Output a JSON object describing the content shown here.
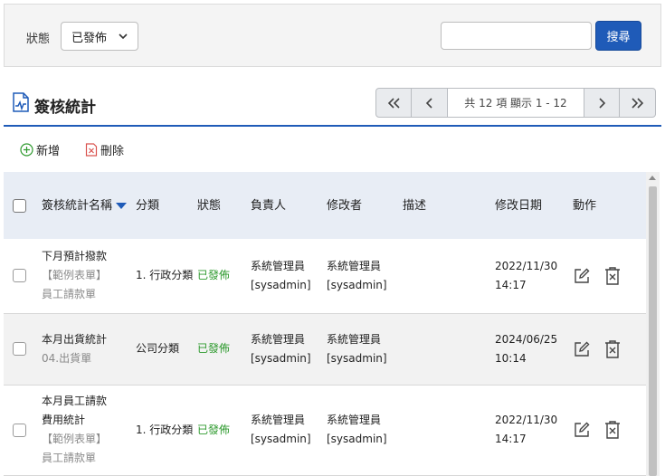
{
  "filter": {
    "status_label": "狀態",
    "status_value": "已發佈",
    "search_placeholder": "",
    "search_button": "搜尋"
  },
  "header": {
    "title": "簽核統計",
    "pager_info": "共 12 項 顯示 1 - 12"
  },
  "toolbar": {
    "add_label": "新增",
    "delete_label": "刪除"
  },
  "table": {
    "columns": {
      "name": "簽核統計名稱",
      "category": "分類",
      "status": "狀態",
      "owner": "負責人",
      "modifier": "修改者",
      "description": "描述",
      "modified_date": "修改日期",
      "actions": "動作"
    },
    "rows": [
      {
        "name_lines": [
          "下月預計撥款"
        ],
        "sub_lines": [
          "【範例表單】",
          "員工請款單"
        ],
        "category": "1. 行政分類",
        "status": "已發佈",
        "owner": "系統管理員[sysadmin]",
        "modifier": "系統管理員[sysadmin]",
        "description": "",
        "date": "2022/11/30",
        "time": "14:17"
      },
      {
        "name_lines": [
          "本月出貨統計"
        ],
        "sub_lines": [
          "04.出貨單"
        ],
        "category": "公司分類",
        "status": "已發佈",
        "owner": "系統管理員[sysadmin]",
        "modifier": "系統管理員[sysadmin]",
        "description": "",
        "date": "2024/06/25",
        "time": "10:14"
      },
      {
        "name_lines": [
          "本月員工請款",
          "費用統計"
        ],
        "sub_lines": [
          "【範例表單】",
          "員工請款單"
        ],
        "category": "1. 行政分類",
        "status": "已發佈",
        "owner": "系統管理員[sysadmin]",
        "modifier": "系統管理員[sysadmin]",
        "description": "",
        "date": "2022/11/30",
        "time": "14:17"
      }
    ]
  },
  "colors": {
    "accent": "#1f5bb8",
    "published": "#2e9a2e",
    "header_bg": "#e8edf5",
    "delete_icon": "#d9534f",
    "add_icon": "#2e9a2e"
  }
}
